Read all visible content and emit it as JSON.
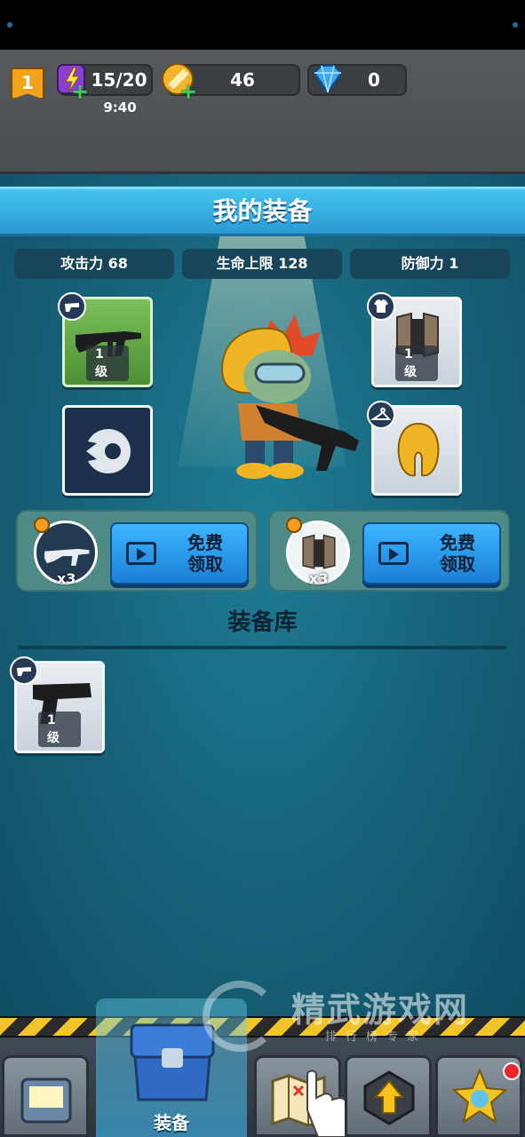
{
  "topbar": {
    "level": "1",
    "energy": "15/20",
    "energy_timer": "9:40",
    "coins": "46",
    "gems": "0"
  },
  "equipment": {
    "title": "我的装备",
    "stats": [
      {
        "label": "攻击力 68"
      },
      {
        "label": "生命上限 128"
      },
      {
        "label": "防御力 1"
      }
    ],
    "slots": {
      "weapon_level": "1 级",
      "armor_level": "1 级"
    },
    "rewards": [
      {
        "count": "x3",
        "button": "免费\n领取"
      },
      {
        "count": "x3",
        "button": "免费\n领取"
      }
    ]
  },
  "inventory": {
    "title": "装备库",
    "items": [
      {
        "level": "1 级",
        "icon": "pistol-icon"
      }
    ]
  },
  "nav": {
    "active_label": "装备"
  },
  "watermark": {
    "main": "精武游戏网",
    "sub": "排行榜专家"
  },
  "colors": {
    "title_bar": "#2a9ad3",
    "panel": "#17637a",
    "reward_button": "#1b7fd6",
    "notification": "#e8262b"
  }
}
